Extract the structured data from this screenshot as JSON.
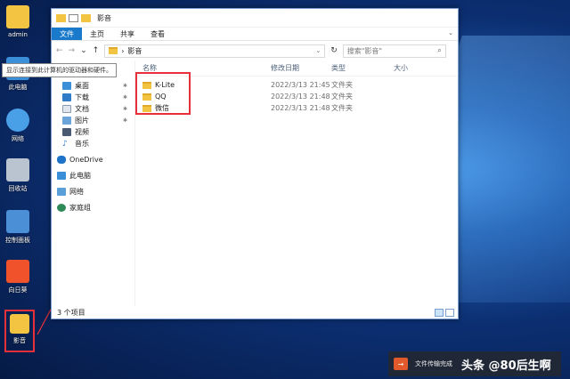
{
  "desktop": {
    "icons": [
      {
        "label": "admin"
      },
      {
        "label": "此电脑"
      },
      {
        "label": "网络"
      },
      {
        "label": "回收站"
      },
      {
        "label": "控制面板"
      },
      {
        "label": "向日葵"
      },
      {
        "label": "影音"
      }
    ]
  },
  "tooltip": "显示连接到此计算机的驱动器和硬件。",
  "window": {
    "title": "影音",
    "ribbon_tabs": [
      "文件",
      "主页",
      "共享",
      "查看"
    ],
    "address": "影音",
    "search_placeholder": "搜索\"影音\"",
    "nav_items": [
      {
        "label": "桌面",
        "icon": "desktop-icon",
        "pinned": true
      },
      {
        "label": "下载",
        "icon": "download-icon",
        "pinned": true
      },
      {
        "label": "文档",
        "icon": "document-icon",
        "pinned": true
      },
      {
        "label": "图片",
        "icon": "picture-icon",
        "pinned": true
      },
      {
        "label": "视频",
        "icon": "video-icon",
        "pinned": false
      },
      {
        "label": "音乐",
        "icon": "music-icon",
        "pinned": false
      }
    ],
    "nav_roots": [
      {
        "label": "OneDrive",
        "icon": "onedrive-icon"
      },
      {
        "label": "此电脑",
        "icon": "this-pc-icon"
      },
      {
        "label": "网络",
        "icon": "network-icon"
      },
      {
        "label": "家庭组",
        "icon": "homegroup-icon"
      }
    ],
    "columns": {
      "name": "名称",
      "date": "修改日期",
      "type": "类型",
      "size": "大小"
    },
    "files": [
      {
        "name": "K-Lite",
        "date": "2022/3/13 21:45",
        "type": "文件夹"
      },
      {
        "name": "QQ",
        "date": "2022/3/13 21:48",
        "type": "文件夹"
      },
      {
        "name": "微信",
        "date": "2022/3/13 21:48",
        "type": "文件夹"
      }
    ],
    "status": "3 个项目"
  },
  "toast": {
    "text": "文件传输完成",
    "watermark": "头条 @80后生啊"
  },
  "colors": {
    "accent": "#1979ca",
    "highlight": "#e8303a",
    "folder": "#f3c441"
  }
}
